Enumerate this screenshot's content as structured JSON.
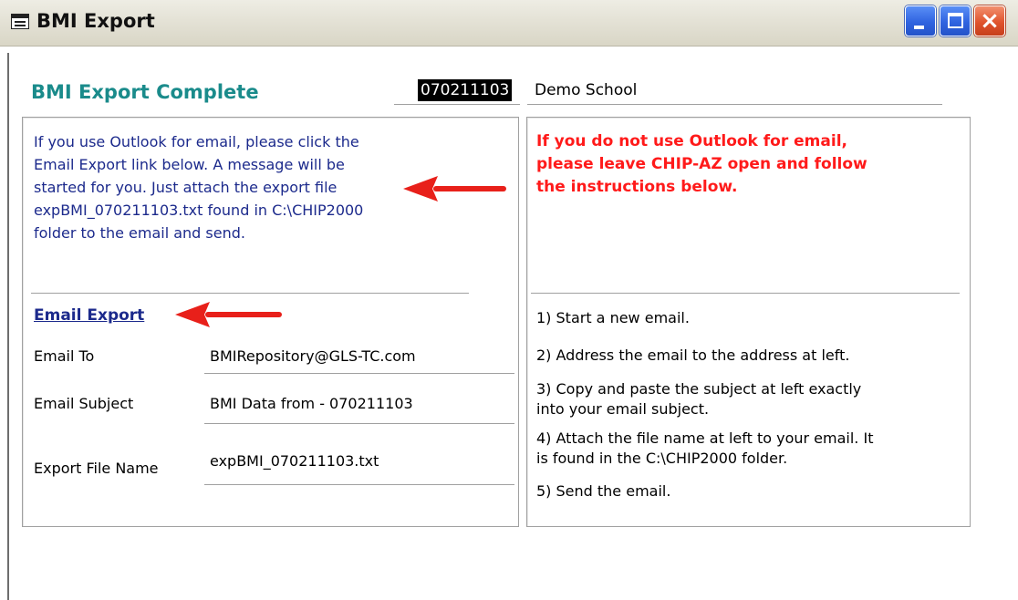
{
  "window": {
    "title": "BMI Export",
    "icon": "form-icon",
    "buttons": {
      "minimize": "minimize-icon",
      "maximize": "maximize-icon",
      "close": "close-icon"
    }
  },
  "header": {
    "title": "BMI Export Complete",
    "school_id": "070211103",
    "school_name": "Demo School"
  },
  "left": {
    "intro_lines": [
      "If you use Outlook for email, please click the",
      "Email Export link below. A message will be",
      "started for you. Just attach the export file",
      "expBMI_070211103.txt found in C:\\CHIP2000",
      "folder to the email and send."
    ],
    "email_export_link": "Email Export",
    "fields": {
      "email_to_label": "Email To",
      "email_to_value": "BMIRepository@GLS-TC.com",
      "subject_label": "Email Subject",
      "subject_value": "BMI Data from - 070211103",
      "file_label": "Export File Name",
      "file_value": "expBMI_070211103.txt"
    }
  },
  "right": {
    "warning_lines": [
      "If you do not use Outlook for email,",
      "please leave CHIP-AZ open and follow",
      "the instructions below."
    ],
    "steps": {
      "s1": "1) Start a new email.",
      "s2": "2) Address the email to the address at left.",
      "s3a": "3) Copy and paste the subject at left exactly",
      "s3b": "into your email subject.",
      "s4a": "4) Attach the file name at left to your email. It",
      "s4b": "is found in the C:\\CHIP2000 folder.",
      "s5": "5) Send the email."
    }
  },
  "colors": {
    "header_title": "#1a8b8b",
    "intro_text": "#1c2a8c",
    "warning_text": "#ff1a1a",
    "annotation_arrow": "#e8201a"
  }
}
